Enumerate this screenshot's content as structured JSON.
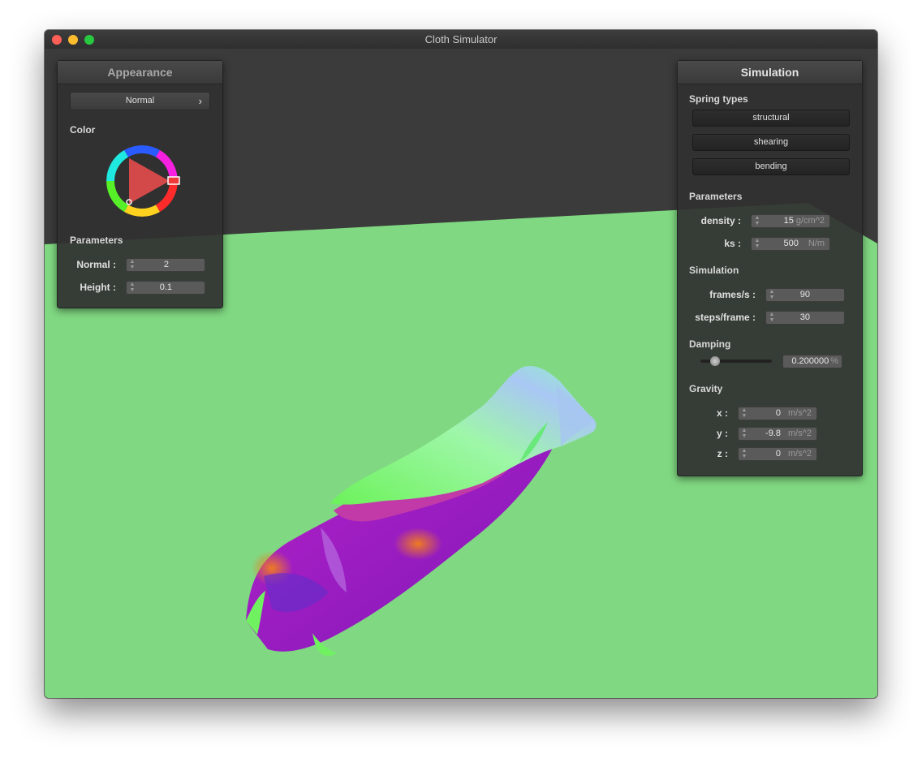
{
  "window": {
    "title": "Cloth Simulator"
  },
  "appearance": {
    "title": "Appearance",
    "shader_dropdown": {
      "value": "Normal",
      "chevron": "›"
    },
    "color_label": "Color",
    "color_wheel_icon": "color-wheel",
    "parameters_label": "Parameters",
    "normal": {
      "label": "Normal :",
      "value": "2"
    },
    "height": {
      "label": "Height :",
      "value": "0.1"
    }
  },
  "simulation": {
    "title": "Simulation",
    "spring_types_label": "Spring types",
    "springs": [
      "structural",
      "shearing",
      "bending"
    ],
    "parameters_label": "Parameters",
    "density": {
      "label": "density :",
      "value": "15",
      "unit": "g/cm^2"
    },
    "ks": {
      "label": "ks :",
      "value": "500",
      "unit": "N/m"
    },
    "simulation_label": "Simulation",
    "frames": {
      "label": "frames/s :",
      "value": "90"
    },
    "steps": {
      "label": "steps/frame :",
      "value": "30"
    },
    "damping_label": "Damping",
    "damping": {
      "value": "0.200000",
      "unit": "%",
      "slider_fraction": 0.2
    },
    "gravity_label": "Gravity",
    "gravity": [
      {
        "label": "x :",
        "value": "0",
        "unit": "m/s^2"
      },
      {
        "label": "y :",
        "value": "-9.8",
        "unit": "m/s^2"
      },
      {
        "label": "z :",
        "value": "0",
        "unit": "m/s^2"
      }
    ]
  },
  "colors": {
    "floor": "#80d982",
    "background": "#3b3b3b",
    "panel": "#303030"
  }
}
